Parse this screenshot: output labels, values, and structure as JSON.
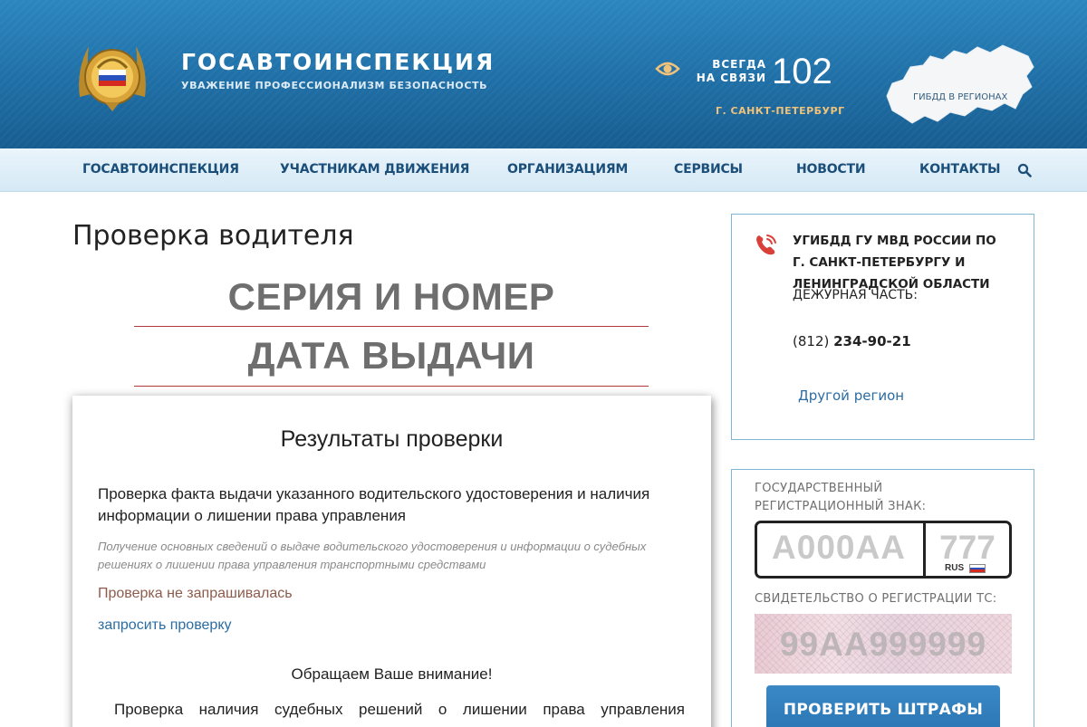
{
  "header": {
    "brand_title": "ГОСАВТОИНСПЕКЦИЯ",
    "brand_subtitle": "УВАЖЕНИЕ ПРОФЕССИОНАЛИЗМ БЕЗОПАСНОСТЬ",
    "always_connected": "ВСЕГДА\nНА СВЯЗИ",
    "hotline": "102",
    "city": "Г. САНКТ-ПЕТЕРБУРГ",
    "map_label": "ГИБДД В РЕГИОНАХ"
  },
  "nav": {
    "items": [
      {
        "label": "ГОСАВТОИНСПЕКЦИЯ"
      },
      {
        "label": "УЧАСТНИКАМ ДВИЖЕНИЯ"
      },
      {
        "label": "ОРГАНИЗАЦИЯМ"
      },
      {
        "label": "СЕРВИСЫ"
      },
      {
        "label": "НОВОСТИ"
      },
      {
        "label": "КОНТАКТЫ"
      }
    ],
    "search_icon": "search-icon"
  },
  "main": {
    "page_title": "Проверка водителя",
    "series_number": "СЕРИЯ И НОМЕР",
    "issue_date": "ДАТА ВЫДАЧИ",
    "results": {
      "title": "Результаты проверки",
      "check_title": "Проверка факта выдачи указанного водительского удостоверения и наличия информации о лишении права управления",
      "check_description": "Получение основных сведений о выдаче водительского удостоверения и информации о судебных решениях о лишении права управления транспортными средствами",
      "status": "Проверка не запрашивалась",
      "request_link": "запросить проверку",
      "attention": "Обращаем Ваше внимание!",
      "note": "Проверка наличия судебных решений о лишении права управления"
    }
  },
  "sidebar": {
    "contact": {
      "department": "УГИБДД ГУ МВД РОССИИ ПО Г. САНКТ-ПЕТЕРБУРГУ И ЛЕНИНГРАДСКОЙ ОБЛАСТИ",
      "duty_label": "ДЕЖУРНАЯ ЧАСТЬ:",
      "phone_code": "(812)",
      "phone_number": "234-90-21",
      "other_region": "Другой регион"
    },
    "registration": {
      "plate_label": "ГОСУДАРСТВЕННЫЙ РЕГИСТРАЦИОННЫЙ ЗНАК:",
      "plate_placeholder": "А000АА",
      "region_placeholder": "777",
      "plate_country": "RUS",
      "sts_label": "СВИДЕТЕЛЬСТВО О РЕГИСТРАЦИИ ТС:",
      "sts_placeholder": "99АА999999",
      "check_fines_button": "ПРОВЕРИТЬ ШТРАФЫ"
    }
  },
  "colors": {
    "header_blue": "#1f6fa6",
    "nav_text": "#1b4f7a",
    "accent_gold": "#f0c27a",
    "divider_red": "#b03a3a",
    "link_blue": "#2b6ca3",
    "status_brown": "#8d5b4c",
    "button_blue": "#2a74b2"
  }
}
